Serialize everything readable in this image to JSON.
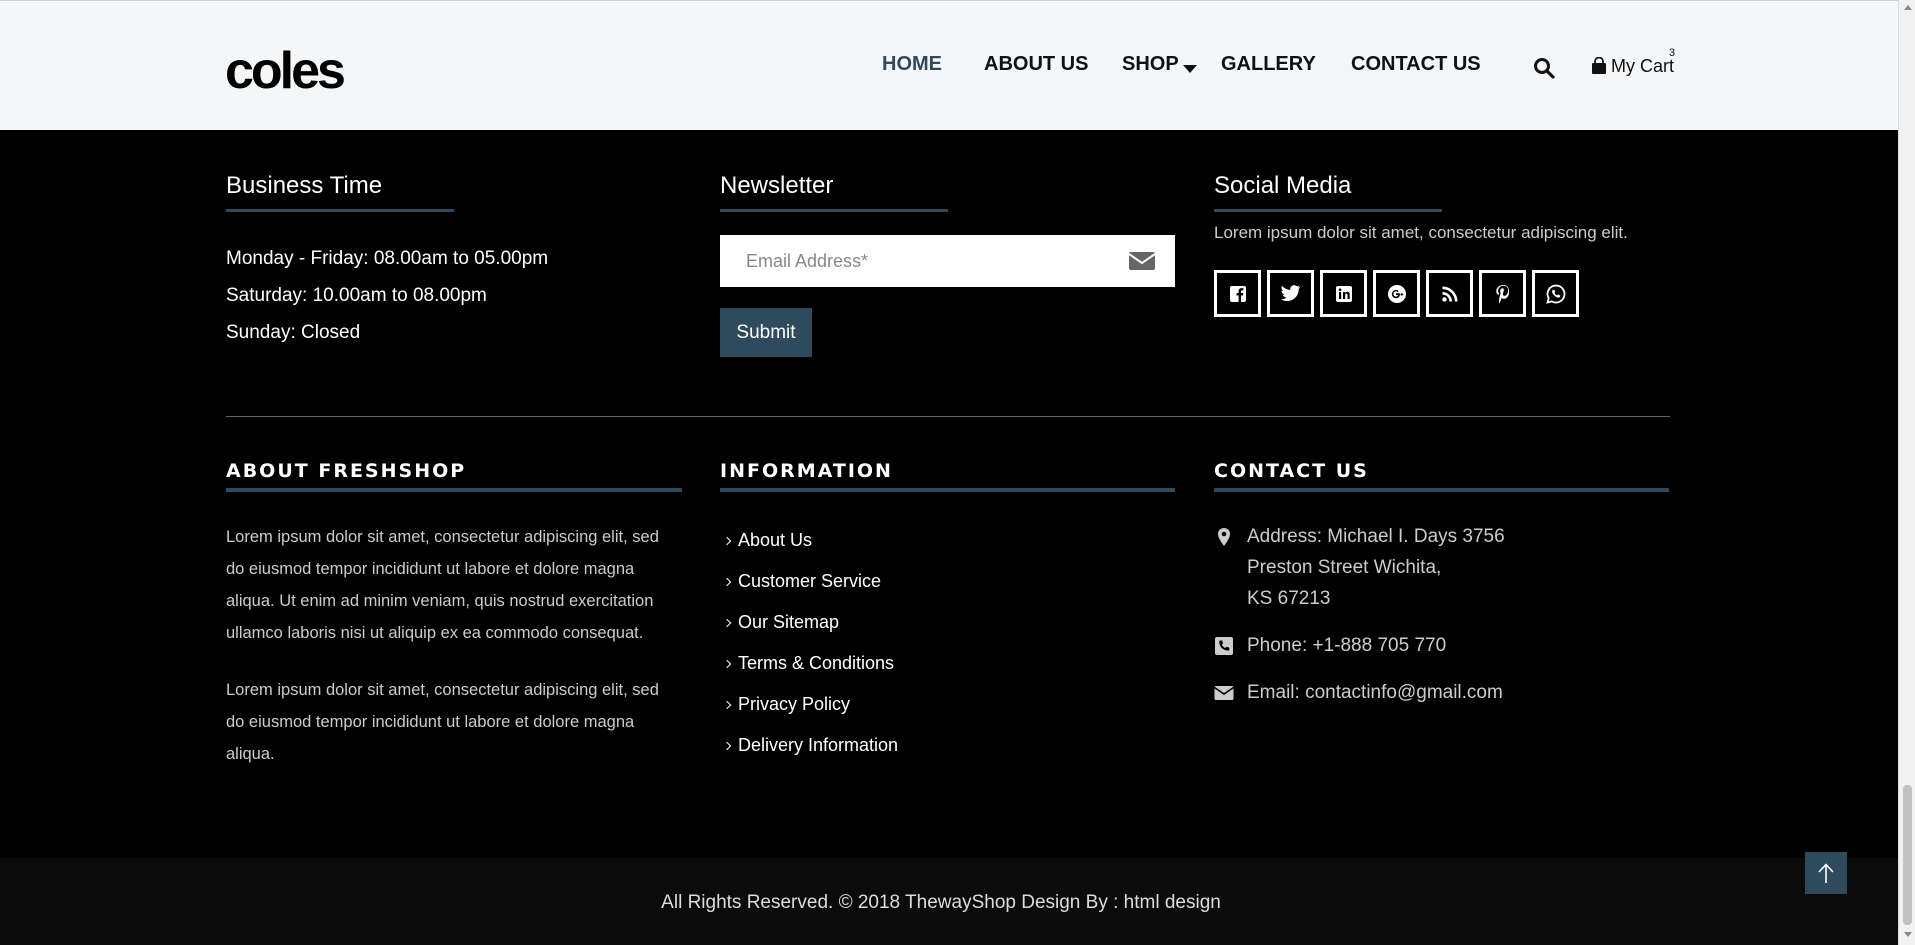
{
  "header": {
    "logo": "coles",
    "nav": [
      {
        "label": "HOME",
        "active": true
      },
      {
        "label": "ABOUT US",
        "active": false
      },
      {
        "label": "SHOP",
        "active": false
      },
      {
        "label": "GALLERY",
        "active": false
      },
      {
        "label": "CONTACT US",
        "active": false
      }
    ],
    "cart_label": "My Cart",
    "cart_count": "3",
    "icons": {
      "search": "search-icon",
      "cart": "shopping-bag-icon",
      "shop_dropdown": "caret-down-icon"
    }
  },
  "business_time": {
    "title": "Business Time",
    "lines": [
      "Monday - Friday: 08.00am to 05.00pm",
      "Saturday: 10.00am to 08.00pm",
      "Sunday: Closed"
    ]
  },
  "newsletter": {
    "title": "Newsletter",
    "placeholder": "Email Address*",
    "submit_label": "Submit",
    "icon": "envelope-icon"
  },
  "social": {
    "title": "Social Media",
    "text": "Lorem ipsum dolor sit amet, consectetur adipiscing elit.",
    "icons": [
      "facebook-icon",
      "twitter-icon",
      "linkedin-icon",
      "google-plus-icon",
      "rss-icon",
      "pinterest-icon",
      "whatsapp-icon"
    ]
  },
  "about": {
    "title": "ABOUT FRESHSHOP",
    "para1": "Lorem ipsum dolor sit amet, consectetur adipiscing elit, sed do eiusmod tempor incididunt ut labore et dolore magna aliqua. Ut enim ad minim veniam, quis nostrud exercitation ullamco laboris nisi ut aliquip ex ea commodo consequat.",
    "para2": "Lorem ipsum dolor sit amet, consectetur adipiscing elit, sed do eiusmod tempor incididunt ut labore et dolore magna aliqua."
  },
  "information": {
    "title": "INFORMATION",
    "links": [
      "About Us",
      "Customer Service",
      "Our Sitemap",
      "Terms & Conditions",
      "Privacy Policy",
      "Delivery Information"
    ]
  },
  "contact": {
    "title": "CONTACT US",
    "address_lines": [
      "Address: Michael I. Days 3756",
      "Preston Street Wichita,",
      "KS 67213"
    ],
    "phone": "Phone: +1-888 705 770",
    "email": "Email: contactinfo@gmail.com",
    "icons": {
      "address": "map-marker-icon",
      "phone": "phone-square-icon",
      "email": "envelope-icon"
    }
  },
  "footer": {
    "copyright": "All Rights Reserved. © 2018 ThewayShop Design By : html design",
    "back_to_top_icon": "arrow-up-icon"
  },
  "colors": {
    "accent": "#2f4a5c",
    "background": "#000000",
    "header_bg": "#f5f6f8"
  }
}
